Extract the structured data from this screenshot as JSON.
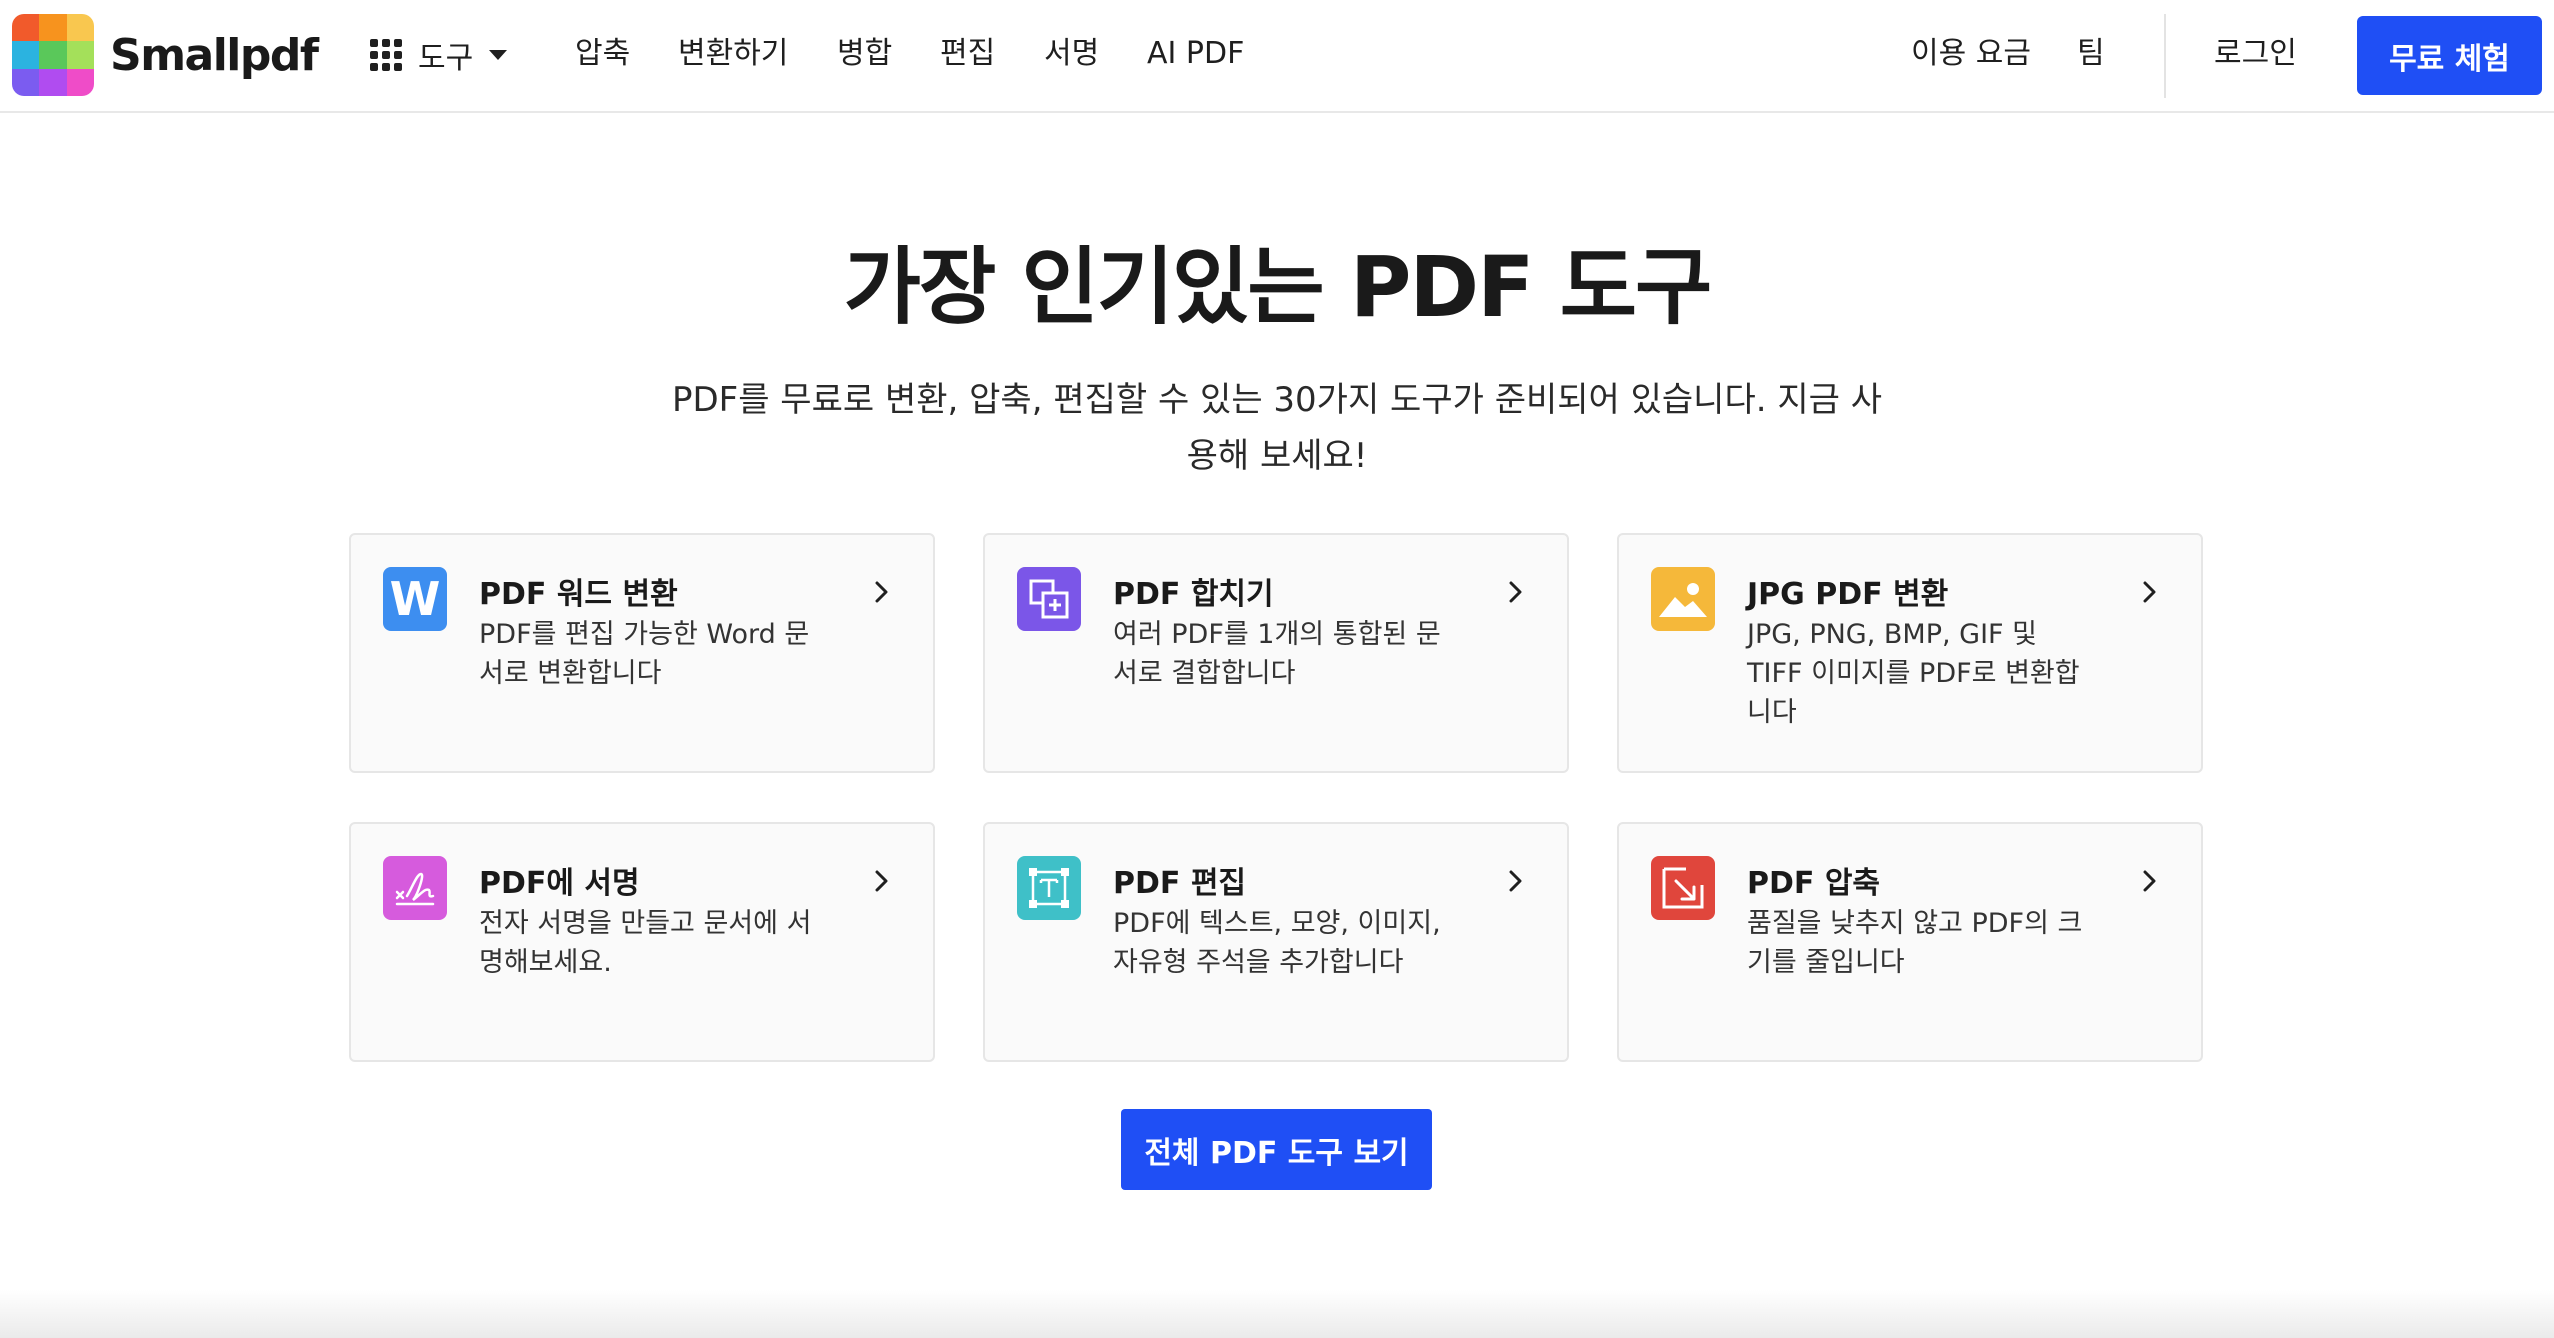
{
  "brand": {
    "name": "Smallpdf",
    "logo_colors": [
      "#f15a2b",
      "#f7931e",
      "#f9c74f",
      "#2bb3e0",
      "#5ac85a",
      "#a4e05a",
      "#7b5cf0",
      "#b04cf0",
      "#ef4cc8"
    ]
  },
  "nav": {
    "tools_label": "도구",
    "links": [
      "압축",
      "변환하기",
      "병합",
      "편집",
      "서명",
      "AI PDF"
    ],
    "pricing": "이용 요금",
    "team": "팀",
    "login": "로그인",
    "trial_button": "무료 체험"
  },
  "hero": {
    "title": "가장 인기있는 PDF 도구",
    "subtitle": "PDF를 무료로 변환, 압축, 편집할 수 있는 30가지 도구가 준비되어 있습니다. 지금 사용해 보세요!"
  },
  "cards": [
    {
      "title": "PDF 워드 변환",
      "desc": "PDF를 편집 가능한 Word 문서로 변환합니다",
      "icon": "word-icon",
      "color": "#3d8ef0"
    },
    {
      "title": "PDF 합치기",
      "desc": "여러 PDF를 1개의 통합된 문서로 결합합니다",
      "icon": "merge-icon",
      "color": "#7b56e8"
    },
    {
      "title": "JPG PDF 변환",
      "desc": "JPG, PNG, BMP, GIF 및 TIFF 이미지를 PDF로 변환합니다",
      "icon": "image-icon",
      "color": "#f5b83a"
    },
    {
      "title": "PDF에 서명",
      "desc": "전자 서명을 만들고 문서에 서명해보세요.",
      "icon": "signature-icon",
      "color": "#d65bdd"
    },
    {
      "title": "PDF 편집",
      "desc": "PDF에 텍스트, 모양, 이미지, 자유형 주석을 추가합니다",
      "icon": "edit-text-icon",
      "color": "#3fc0c8"
    },
    {
      "title": "PDF 압축",
      "desc": "품질을 낮추지 않고 PDF의 크기를 줄입니다",
      "icon": "compress-icon",
      "color": "#e0463c"
    }
  ],
  "all_tools_button": "전체 PDF 도구 보기",
  "accent": "#1f4ff5"
}
